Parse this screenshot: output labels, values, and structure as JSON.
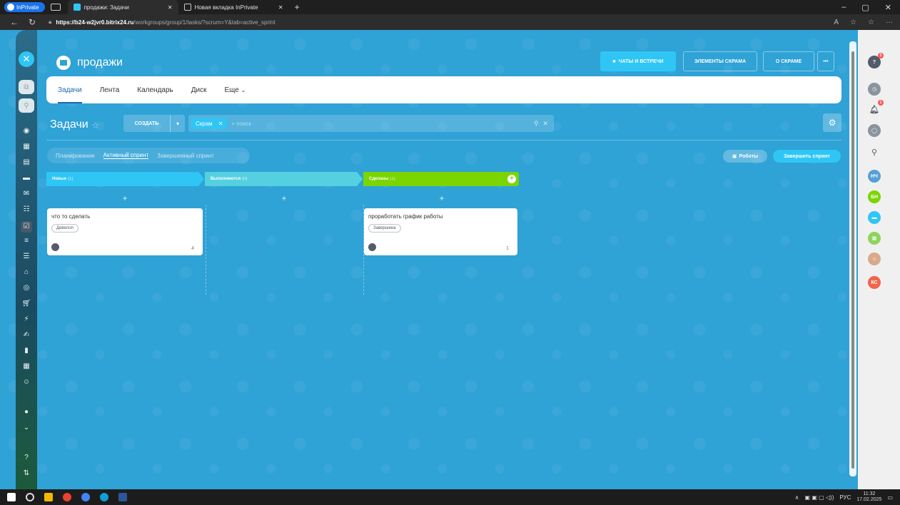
{
  "browser": {
    "inprivate_label": "InPrivate",
    "tabs": [
      {
        "title": "продажи: Задачи"
      },
      {
        "title": "Новая вкладка InPrivate"
      }
    ],
    "url_host": "https://b24-w2jvr0.bitrix24.ru",
    "url_path": "/workgroups/group/1/tasks/?scrum=Y&tab=active_sprint"
  },
  "header": {
    "project_title": "продажи",
    "buttons": {
      "chats": "ЧАТЫ И ВСТРЕЧИ",
      "scrum_elements": "ЭЛЕМЕНТЫ СКРАМА",
      "about_scrum": "О СКРАМЕ",
      "more": "•••"
    }
  },
  "nav": {
    "tabs": [
      "Задачи",
      "Лента",
      "Календарь",
      "Диск",
      "Еще"
    ]
  },
  "toolbar": {
    "title": "Задачи",
    "create_label": "СОЗДАТЬ",
    "filter_chip": "Скрам",
    "search_placeholder": "+ поиск"
  },
  "sprint": {
    "tabs": [
      "Планирование",
      "Активный спринт",
      "Завершенный спринт"
    ],
    "robots_label": "Роботы",
    "finish_label": "Завершить спринт"
  },
  "columns": [
    {
      "title": "Новые",
      "count": "(1)",
      "color": "#2fc6f6"
    },
    {
      "title": "Выполняются",
      "count": "(0)",
      "color": "#55d0e0"
    },
    {
      "title": "Сделаны",
      "count": "(1)",
      "color": "#7bd500"
    }
  ],
  "cards": [
    {
      "title": "что то сделать",
      "tag": "Девелоп",
      "count": "4"
    },
    {
      "title": "проработать график работы",
      "tag": "Завершена",
      "count": "1"
    }
  ],
  "right_panel": {
    "avatars": [
      "НЧ",
      "БН",
      "КС"
    ],
    "badges": {
      "help": "5",
      "notifications": "1"
    }
  },
  "taskbar": {
    "lang": "РУС",
    "time": "11:32",
    "date": "17.02.2025"
  }
}
